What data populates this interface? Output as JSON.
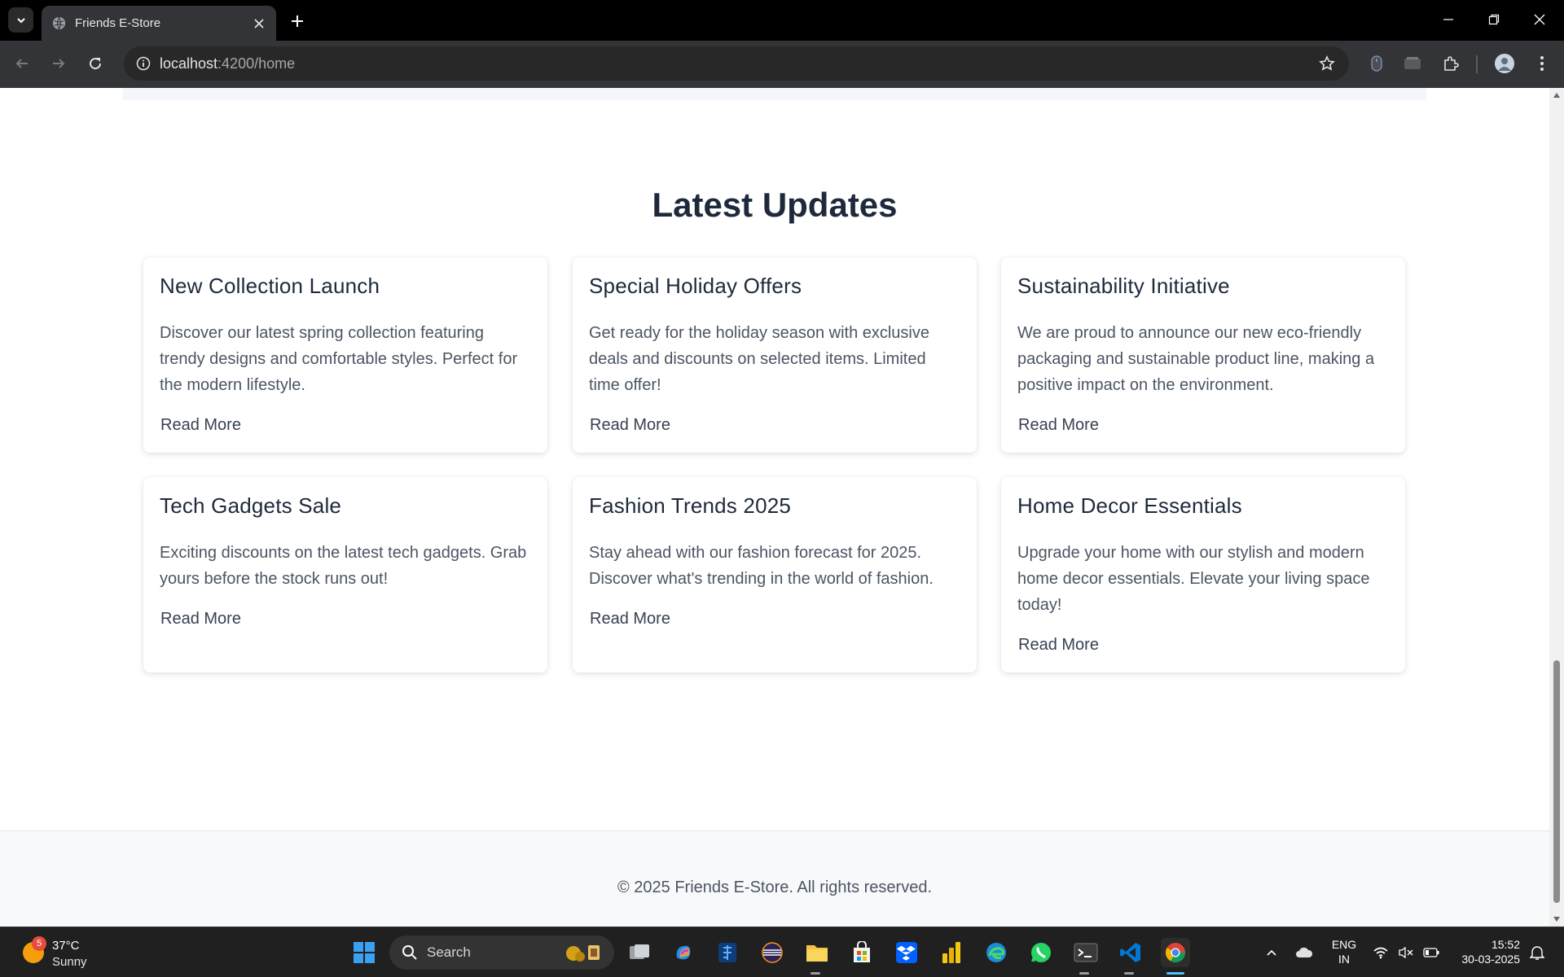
{
  "browser": {
    "tab_title": "Friends E-Store",
    "url_host": "localhost",
    "url_path": ":4200/home"
  },
  "page": {
    "section_title": "Latest Updates",
    "cards": [
      {
        "title": "New Collection Launch",
        "body": "Discover our latest spring collection featuring trendy designs and comfortable styles. Perfect for the modern lifestyle.",
        "link": "Read More"
      },
      {
        "title": "Special Holiday Offers",
        "body": "Get ready for the holiday season with exclusive deals and discounts on selected items. Limited time offer!",
        "link": "Read More"
      },
      {
        "title": "Sustainability Initiative",
        "body": "We are proud to announce our new eco-friendly packaging and sustainable product line, making a positive impact on the environment.",
        "link": "Read More"
      },
      {
        "title": "Tech Gadgets Sale",
        "body": "Exciting discounts on the latest tech gadgets. Grab yours before the stock runs out!",
        "link": "Read More"
      },
      {
        "title": "Fashion Trends 2025",
        "body": "Stay ahead with our fashion forecast for 2025. Discover what's trending in the world of fashion.",
        "link": "Read More"
      },
      {
        "title": "Home Decor Essentials",
        "body": "Upgrade your home with our stylish and modern home decor essentials. Elevate your living space today!",
        "link": "Read More"
      }
    ],
    "footer_text": "© 2025 Friends E-Store. All rights reserved."
  },
  "taskbar": {
    "weather_temp": "37°C",
    "weather_condition": "Sunny",
    "weather_badge": "5",
    "search_label": "Search",
    "lang_line1": "ENG",
    "lang_line2": "IN",
    "time": "15:52",
    "date": "30-03-2025"
  }
}
